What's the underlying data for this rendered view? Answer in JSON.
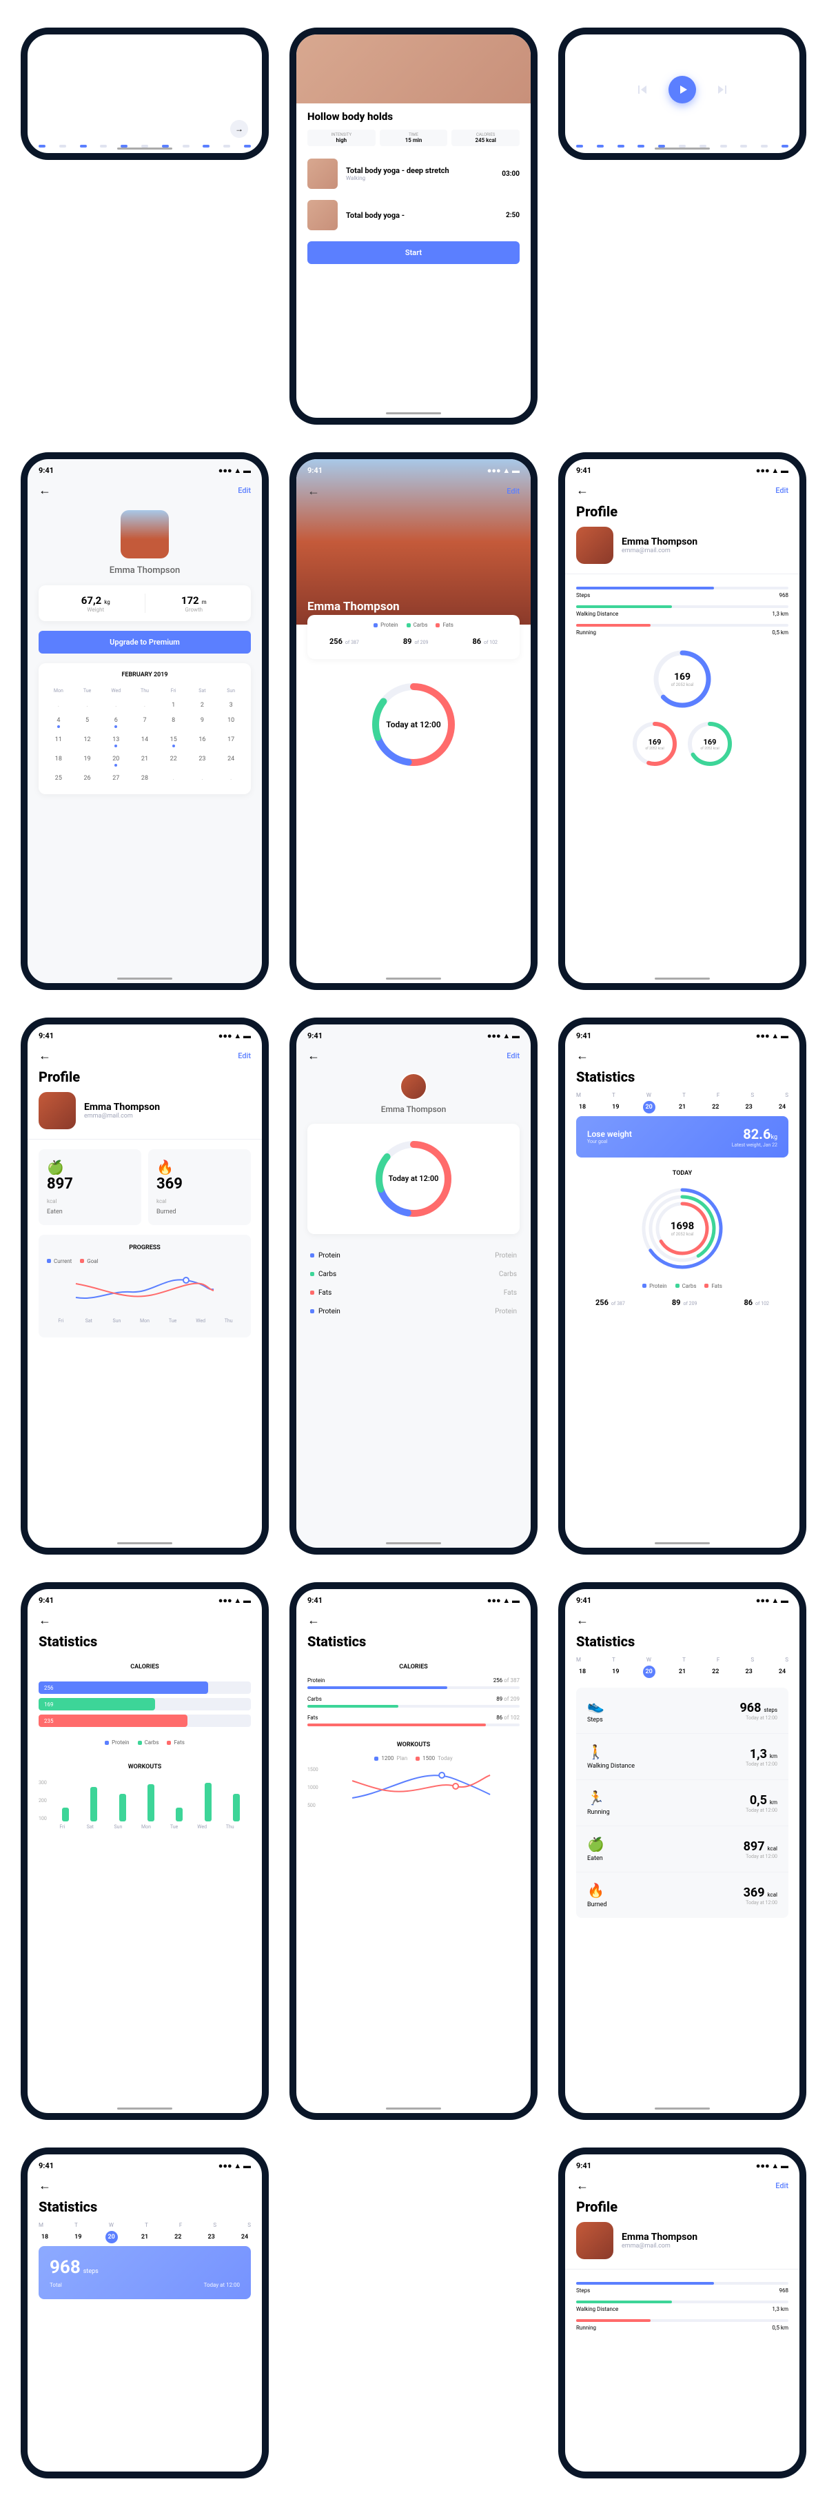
{
  "status": {
    "time": "9:41"
  },
  "user": {
    "name": "Emma Thompson",
    "email": "emma@mail.com"
  },
  "edit": "Edit",
  "profile_title": "Profile",
  "stats_title": "Statistics",
  "upgrade": "Upgrade to Premium",
  "start": "Start",
  "today_at": "Today at 12:00",
  "today": "TODAY",
  "workout": {
    "name": "Hollow body holds",
    "meta": {
      "intensity_label": "INTENSITY",
      "intensity_val": "high",
      "time_label": "TIME",
      "time_val": "15 min",
      "cal_label": "CALORIES",
      "cal_val": "245 kcal"
    },
    "items": [
      {
        "title": "Total body yoga - deep stretch",
        "sub": "Walking",
        "dur": "03:00"
      },
      {
        "title": "Total body yoga -",
        "sub": "",
        "dur": "2:50"
      }
    ]
  },
  "weight": {
    "val": "67,2",
    "unit": "kg",
    "label": "Weight"
  },
  "height": {
    "val": "172",
    "unit": "m",
    "label": "Growth"
  },
  "calendar": {
    "month": "FEBRUARY 2019",
    "days": [
      "Mon",
      "Tue",
      "Wed",
      "Thu",
      "Fri",
      "Sat",
      "Sun"
    ]
  },
  "macros": {
    "protein": {
      "label": "Protein",
      "val": "256",
      "of": "of 387"
    },
    "carbs": {
      "label": "Carbs",
      "val": "89",
      "of": "of 209"
    },
    "fats": {
      "label": "Fats",
      "val": "86",
      "of": "of 102"
    }
  },
  "eaten": {
    "val": "897",
    "unit": "kcal",
    "label": "Eaten"
  },
  "burned": {
    "val": "369",
    "unit": "kcal",
    "label": "Burned"
  },
  "progress_label": "PROGRESS",
  "calories_label": "CALORIES",
  "workouts_label": "WORKOUTS",
  "legend": {
    "current": "Current",
    "goal": "Goal",
    "protein": "Protein",
    "carbs": "Carbs",
    "fats": "Fats",
    "plan": "Plan",
    "today": "Today"
  },
  "bars": {
    "protein": "256",
    "carbs": "169",
    "fats": "235"
  },
  "ring_small": {
    "val": "169",
    "of": "of 2052 kcal"
  },
  "ring_main": {
    "val": "1698",
    "of": "of 2052 kcal"
  },
  "week_labels": [
    "M",
    "T",
    "W",
    "T",
    "F",
    "S",
    "S"
  ],
  "week_dates": [
    "18",
    "19",
    "20",
    "21",
    "22",
    "23",
    "24"
  ],
  "lose": {
    "title": "Lose weight",
    "sub": "Your goal",
    "val": "82.6",
    "unit": "kg",
    "meta": "Latest weight, Jan 22"
  },
  "stats_list": {
    "steps": {
      "label": "Steps",
      "val": "968",
      "unit": "steps"
    },
    "walking": {
      "label": "Walking Distance",
      "val": "1,3",
      "unit": "km"
    },
    "running": {
      "label": "Running",
      "val": "0,5",
      "unit": "km"
    },
    "eaten": {
      "label": "Eaten",
      "val": "897",
      "unit": "kcal"
    },
    "burned": {
      "label": "Burned",
      "val": "369",
      "unit": "kcal"
    }
  },
  "progress_mini": {
    "steps": {
      "label": "Steps",
      "val": "968"
    },
    "walking": {
      "label": "Walking Distance",
      "val": "1,3 km"
    },
    "running": {
      "label": "Running",
      "val": "0,5 km"
    }
  },
  "total": {
    "val": "968",
    "unit": "steps",
    "label": "Total"
  },
  "plan_legend": {
    "plan": "1200",
    "today": "1500"
  },
  "xaxis": [
    "Fri",
    "Sat",
    "Sun",
    "Mon",
    "Tue",
    "Wed",
    "Thu"
  ],
  "yaxis_workouts": [
    "300",
    "200",
    "100"
  ],
  "yaxis_plan": [
    "1500",
    "1000",
    "500"
  ],
  "chart_data": {
    "calories_bars": {
      "type": "bar",
      "categories": [
        "Protein",
        "Carbs",
        "Fats"
      ],
      "values": [
        256,
        169,
        235
      ]
    },
    "workouts_bars": {
      "type": "bar",
      "categories": [
        "Fri",
        "Sat",
        "Sun",
        "Mon",
        "Tue",
        "Wed",
        "Thu"
      ],
      "values": [
        100,
        250,
        200,
        270,
        100,
        280,
        200
      ],
      "ylim": [
        0,
        300
      ]
    },
    "progress_line": {
      "type": "line",
      "categories": [
        "Fri",
        "Sat",
        "Sun",
        "Mon",
        "Tue",
        "Wed",
        "Thu"
      ],
      "series": [
        {
          "name": "Current",
          "values": [
            80,
            70,
            90,
            110,
            140,
            160,
            130
          ]
        },
        {
          "name": "Goal",
          "values": [
            140,
            120,
            100,
            90,
            110,
            140,
            130
          ]
        }
      ]
    },
    "plan_today_line": {
      "type": "line",
      "categories": [
        "Fri",
        "Sat",
        "Sun",
        "Mon",
        "Tue",
        "Wed",
        "Thu"
      ],
      "series": [
        {
          "name": "Plan",
          "values": [
            800,
            900,
            1100,
            1300,
            1400,
            1200,
            1000
          ]
        },
        {
          "name": "Today",
          "values": [
            1200,
            1000,
            900,
            1000,
            1200,
            1100,
            1300
          ]
        }
      ],
      "ylim": [
        500,
        1500
      ]
    }
  }
}
